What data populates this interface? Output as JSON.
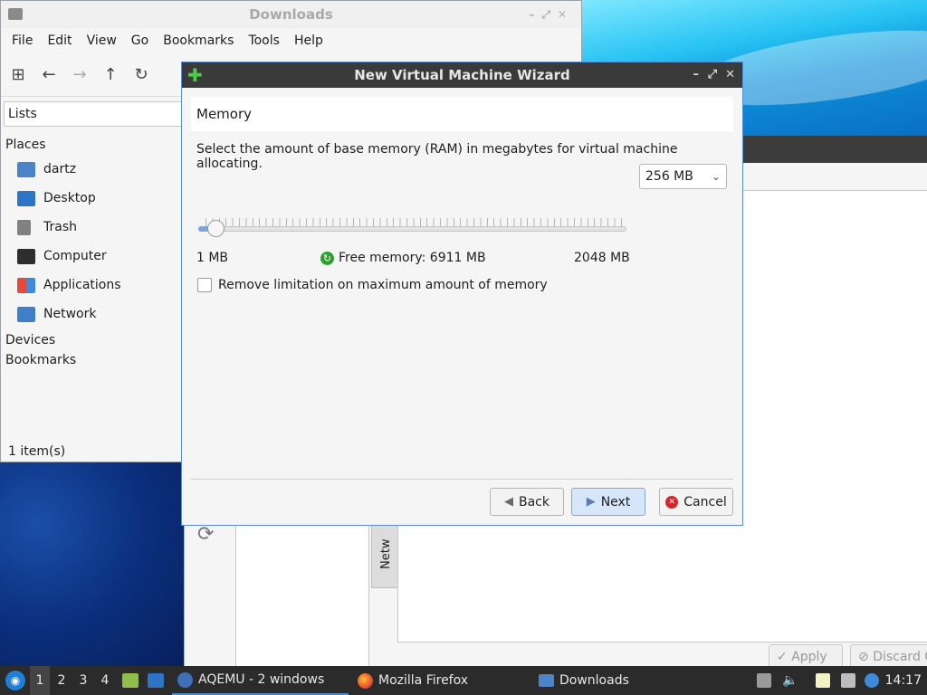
{
  "file_manager": {
    "title": "Downloads",
    "menu": [
      "File",
      "Edit",
      "View",
      "Go",
      "Bookmarks",
      "Tools",
      "Help"
    ],
    "sidebar_mode": "Lists",
    "places_label": "Places",
    "places": [
      "dartz",
      "Desktop",
      "Trash",
      "Computer",
      "Applications",
      "Network"
    ],
    "devices_label": "Devices",
    "bookmarks_label": "Bookmarks",
    "status": "1 item(s)"
  },
  "aqemu_background": {
    "vertical_tab": "Netw",
    "apply_button": "Apply",
    "discard_button": "Discard C"
  },
  "wizard": {
    "title": "New Virtual Machine Wizard",
    "page_title": "Memory",
    "description": "Select the amount of base memory (RAM) in megabytes for virtual machine allocating.",
    "memory_selected": "256 MB",
    "slider": {
      "min_label": "1 MB",
      "max_label": "2048 MB",
      "min": 1,
      "max": 2048,
      "value": 32
    },
    "free_memory": "Free memory: 6911 MB",
    "remove_limit_label": "Remove limitation on maximum amount of memory",
    "remove_limit_checked": false,
    "buttons": {
      "back": "Back",
      "next": "Next",
      "cancel": "Cancel"
    }
  },
  "taskbar": {
    "workspaces": [
      "1",
      "2",
      "3",
      "4"
    ],
    "tasks": [
      {
        "label": "AQEMU - 2 windows",
        "icon": "aqemu-icon",
        "active": true
      },
      {
        "label": "Mozilla Firefox",
        "icon": "firefox-icon",
        "active": false
      },
      {
        "label": "Downloads",
        "icon": "folder-icon",
        "active": false
      }
    ],
    "clock": "14:17"
  },
  "colors": {
    "wizard_titlebar": "#3a3a3a",
    "slider_fill": "#7aa7dc",
    "primary_button": "#d7e6f8",
    "taskbar": "#2b2b2b"
  }
}
